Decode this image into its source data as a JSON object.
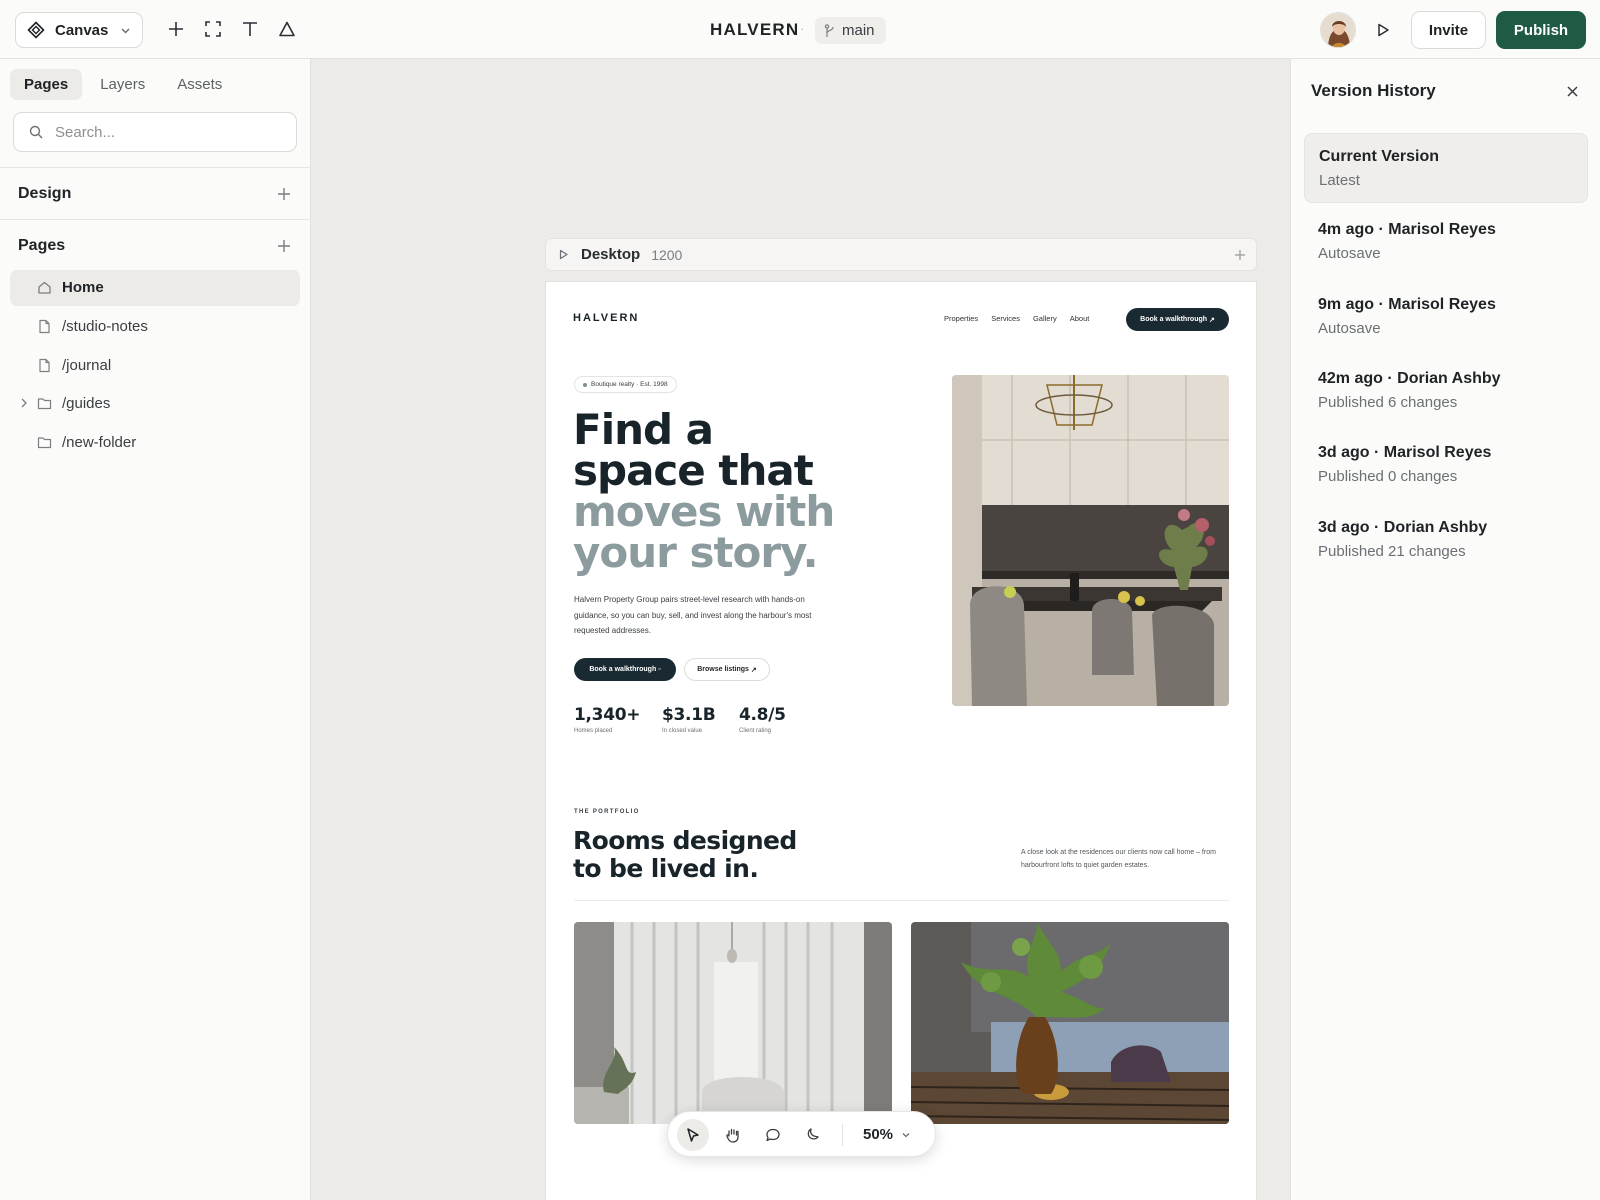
{
  "topbar": {
    "app_label": "Canvas",
    "project_name": "HALVERN",
    "separator": "·",
    "branch": "main",
    "invite_label": "Invite",
    "publish_label": "Publish",
    "tools": [
      "plus-icon",
      "frame-icon",
      "text-icon",
      "shape-icon"
    ]
  },
  "sidebar": {
    "tabs": [
      {
        "label": "Pages",
        "active": true
      },
      {
        "label": "Layers",
        "active": false
      },
      {
        "label": "Assets",
        "active": false
      }
    ],
    "search_placeholder": "Search...",
    "sections": {
      "design": "Design",
      "pages": "Pages"
    },
    "pages": [
      {
        "label": "Home",
        "icon": "home-icon",
        "active": true
      },
      {
        "label": "/studio-notes",
        "icon": "file-icon"
      },
      {
        "label": "/journal",
        "icon": "file-icon"
      },
      {
        "label": "/guides",
        "icon": "folder-icon",
        "collapsible": true
      },
      {
        "label": "/new-folder",
        "icon": "folder-icon"
      }
    ]
  },
  "canvas": {
    "frame_name": "Desktop",
    "frame_width": "1200",
    "site": {
      "logo": "HALVERN",
      "nav": [
        "Properties",
        "Services",
        "Gallery",
        "About"
      ],
      "nav_cta": "Book a walkthrough",
      "badge": "Boutique realty · Est. 1998",
      "hero_line1": "Find a",
      "hero_line2": "space that",
      "hero_line3": "moves with",
      "hero_line4": "your story.",
      "hero_paragraph": "Halvern Property Group pairs street-level research with hands-on guidance, so you can buy, sell, and invest along the harbour's most requested addresses.",
      "btn_primary": "Book a walkthrough",
      "btn_secondary": "Browse listings",
      "stats": [
        {
          "value": "1,340+",
          "label": "Homes placed"
        },
        {
          "value": "$3.1B",
          "label": "In closed value"
        },
        {
          "value": "4.8/5",
          "label": "Client rating"
        }
      ],
      "portfolio_eyebrow": "THE PORTFOLIO",
      "portfolio_line1": "Rooms designed",
      "portfolio_line2": "to be lived in.",
      "portfolio_desc": "A close look at the residences our clients now call home – from harbourfront lofts to quiet garden estates."
    }
  },
  "float_toolbar": {
    "tools": [
      "pointer-icon",
      "hand-icon",
      "comment-icon",
      "moon-icon"
    ],
    "zoom": "50%"
  },
  "version_history": {
    "title": "Version History",
    "versions": [
      {
        "title": "Current Version",
        "sub": "Latest",
        "active": true
      },
      {
        "title": "4m ago · Marisol Reyes",
        "sub": "Autosave"
      },
      {
        "title": "9m ago · Marisol Reyes",
        "sub": "Autosave"
      },
      {
        "title": "42m ago · Dorian Ashby",
        "sub": "Published 6 changes"
      },
      {
        "title": "3d ago · Marisol Reyes",
        "sub": "Published 0 changes"
      },
      {
        "title": "3d ago · Dorian Ashby",
        "sub": "Published 21 changes"
      }
    ]
  },
  "colors": {
    "publish": "#1f5a44",
    "site_dark": "#1a2a33",
    "hero_muted": "#8c9c9e"
  }
}
